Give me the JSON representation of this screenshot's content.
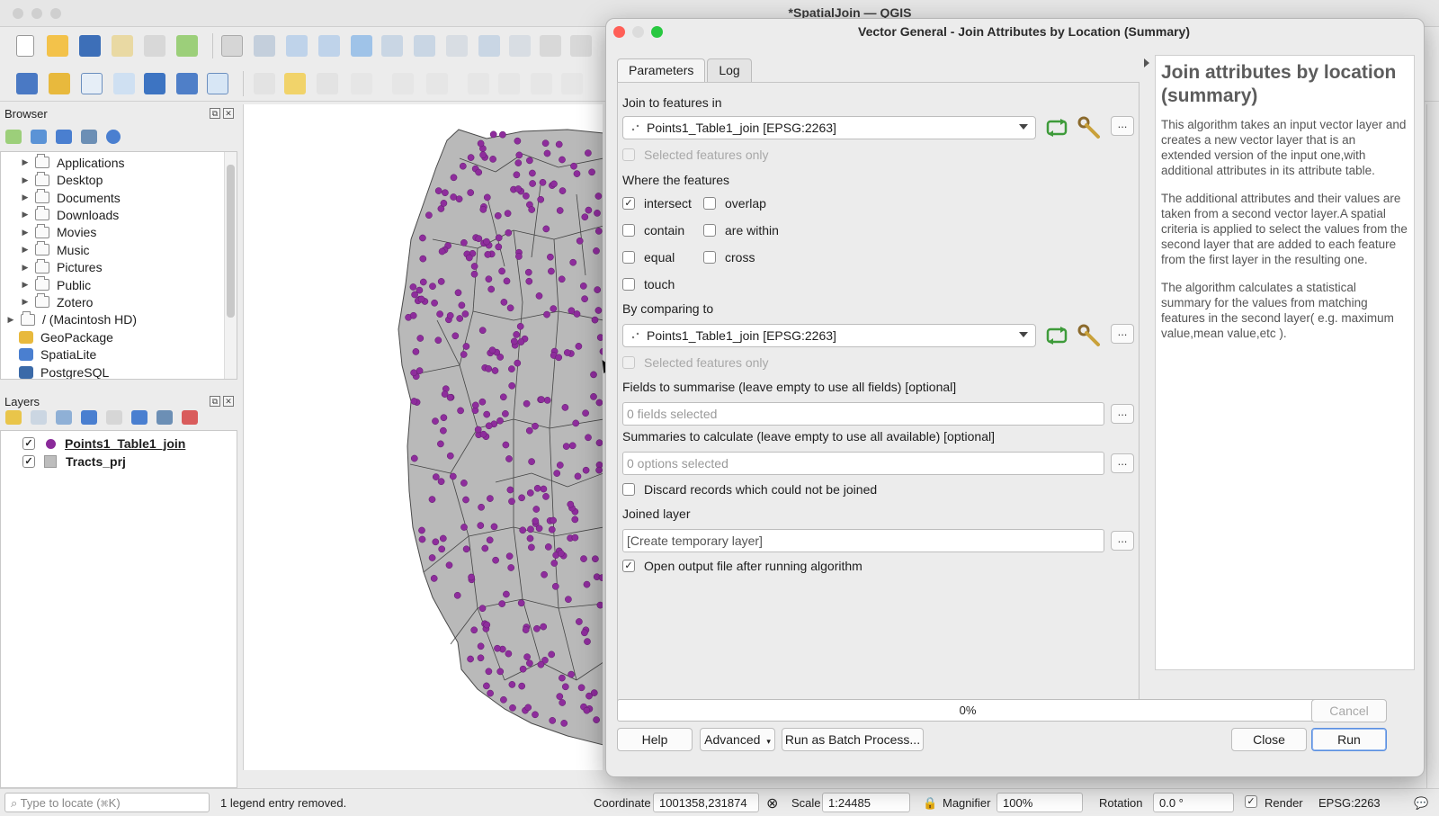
{
  "app": {
    "window_title": "*SpatialJoin — QGIS"
  },
  "browser": {
    "title": "Browser",
    "items": [
      {
        "label": "Applications",
        "type": "folder"
      },
      {
        "label": "Desktop",
        "type": "folder"
      },
      {
        "label": "Documents",
        "type": "folder"
      },
      {
        "label": "Downloads",
        "type": "folder"
      },
      {
        "label": "Movies",
        "type": "folder"
      },
      {
        "label": "Music",
        "type": "folder"
      },
      {
        "label": "Pictures",
        "type": "folder"
      },
      {
        "label": "Public",
        "type": "folder"
      },
      {
        "label": "Zotero",
        "type": "folder"
      },
      {
        "label": "/ (Macintosh HD)",
        "type": "folder"
      },
      {
        "label": "GeoPackage",
        "type": "geopackage"
      },
      {
        "label": "SpatiaLite",
        "type": "spatialite"
      },
      {
        "label": "PostgreSQL",
        "type": "postgresql"
      }
    ]
  },
  "layers": {
    "title": "Layers",
    "items": [
      {
        "label": "Points1_Table1_join",
        "checked": true,
        "symbol_color": "#8a2a9a"
      },
      {
        "label": "Tracts_prj",
        "checked": true,
        "symbol_color": "#bdbdbd"
      }
    ]
  },
  "statusbar": {
    "locate_placeholder": "Type to locate (⌘K)",
    "message": "1 legend entry removed.",
    "coordinate_label": "Coordinate",
    "coordinate_value": "1001358,231874",
    "scale_label": "Scale",
    "scale_value": "1:24485",
    "magnifier_label": "Magnifier",
    "magnifier_value": "100%",
    "rotation_label": "Rotation",
    "rotation_value": "0.0 °",
    "render_label": "Render",
    "crs_label": "EPSG:2263"
  },
  "dialog": {
    "title": "Vector General - Join Attributes by Location (Summary)",
    "tabs": [
      "Parameters",
      "Log"
    ],
    "join_to_label": "Join to features in",
    "join_to_value": "Points1_Table1_join [EPSG:2263]",
    "selected_only_label": "Selected features only",
    "where_label": "Where the features",
    "predicates": [
      {
        "label": "intersect",
        "checked": true
      },
      {
        "label": "overlap",
        "checked": false
      },
      {
        "label": "contain",
        "checked": false
      },
      {
        "label": "are within",
        "checked": false
      },
      {
        "label": "equal",
        "checked": false
      },
      {
        "label": "cross",
        "checked": false
      },
      {
        "label": "touch",
        "checked": false
      }
    ],
    "compare_label": "By comparing to",
    "compare_value": "Points1_Table1_join [EPSG:2263]",
    "fields_label": "Fields to summarise (leave empty to use all fields) [optional]",
    "fields_placeholder": "0 fields selected",
    "summaries_label": "Summaries to calculate (leave empty to use all available) [optional]",
    "summaries_placeholder": "0 options selected",
    "discard_label": "Discard records which could not be joined",
    "joined_layer_label": "Joined layer",
    "joined_layer_placeholder": "[Create temporary layer]",
    "open_output_label": "Open output file after running algorithm",
    "open_output_checked": true,
    "dots": "...",
    "progress_text": "0%",
    "buttons": {
      "cancel": "Cancel",
      "help": "Help",
      "advanced": "Advanced",
      "batch": "Run as Batch Process...",
      "close": "Close",
      "run": "Run"
    },
    "help": {
      "title": "Join attributes by location (summary)",
      "paragraphs": [
        "This algorithm takes an input vector layer and creates a new vector layer that is an extended version of the input one,with additional attributes in its attribute table.",
        "The additional attributes and their values are taken from a second vector layer.A spatial criteria is applied to select the values from the second layer that are added to each feature from the first layer in the resulting one.",
        "The algorithm calculates a statistical summary for the values from matching features in the second layer( e.g. maximum value,mean value,etc )."
      ]
    }
  },
  "colors": {
    "point_fill": "#8e2d9c",
    "polygon_fill": "#b9b9b9",
    "accent": "#5a8fe0",
    "tl_close": "#ff5f57",
    "tl_min": "#dcdcdc",
    "tl_max": "#28c840"
  }
}
